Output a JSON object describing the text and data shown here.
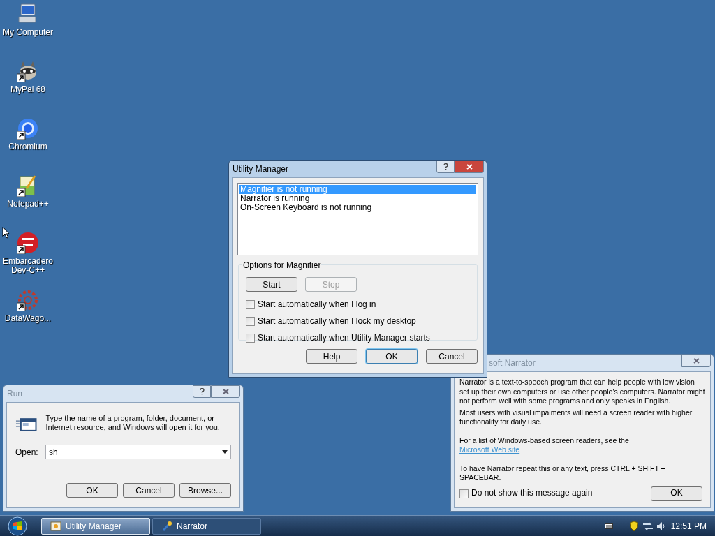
{
  "desktop_icons": [
    {
      "label": "My Computer",
      "kind": "computer",
      "shortcut": false
    },
    {
      "label": "MyPal 68",
      "kind": "raccoon",
      "shortcut": true
    },
    {
      "label": "Chromium",
      "kind": "browser",
      "shortcut": true
    },
    {
      "label": "Notepad++",
      "kind": "notepad",
      "shortcut": true
    },
    {
      "label": "Embarcadero Dev-C++",
      "kind": "dev",
      "shortcut": true
    },
    {
      "label": "DataWago...",
      "kind": "gear",
      "shortcut": true
    }
  ],
  "utility_manager": {
    "title": "Utility Manager",
    "active": true,
    "utilities": [
      {
        "text": "Magnifier is not running",
        "selected": true
      },
      {
        "text": "Narrator is running",
        "selected": false
      },
      {
        "text": "On-Screen Keyboard is not running",
        "selected": false
      }
    ],
    "options_label": "Options for Magnifier",
    "action_buttons": [
      {
        "label": "Start",
        "disabled": false
      },
      {
        "label": "Stop",
        "disabled": true
      }
    ],
    "options": [
      {
        "label": "Start automatically when I log in",
        "checked": false
      },
      {
        "label": "Start automatically when I lock my desktop",
        "checked": false
      },
      {
        "label": "Start automatically when Utility Manager starts",
        "checked": false
      }
    ],
    "buttons": [
      {
        "label": "Help",
        "default": false
      },
      {
        "label": "OK",
        "default": true
      },
      {
        "label": "Cancel",
        "default": false
      }
    ]
  },
  "run_dialog": {
    "title": "Run",
    "active": false,
    "message": "Type the name of a program, folder, document, or Internet resource, and Windows will open it for you.",
    "open_label": "Open:",
    "open_value": "sh",
    "buttons": [
      {
        "label": "OK",
        "default": false
      },
      {
        "label": "Cancel",
        "default": false
      },
      {
        "label": "Browse...",
        "default": false
      }
    ]
  },
  "narrator": {
    "title": "soft Narrator",
    "active": false,
    "paragraphs": [
      "Narrator is a text-to-speech program that can help people with low vision set up their own computers or use other people's computers. Narrator might not perform well with some programs and only speaks in English.",
      "Most users with visual impaiments will need a screen reader with higher functionality for daily use.",
      "For a list of Windows-based screen readers, see the"
    ],
    "link": "Microsoft Web site",
    "hint": "To have Narrator repeat this or any text, press CTRL + SHIFT + SPACEBAR.",
    "dont_show": {
      "label": "Do not show this message again",
      "checked": false
    },
    "ok": "OK"
  },
  "taskbar": {
    "tasks": [
      {
        "label": "Utility Manager",
        "selected": true,
        "kind": "utility"
      },
      {
        "label": "Narrator",
        "selected": false,
        "kind": "narrator"
      }
    ],
    "clock": "12:51 PM"
  }
}
